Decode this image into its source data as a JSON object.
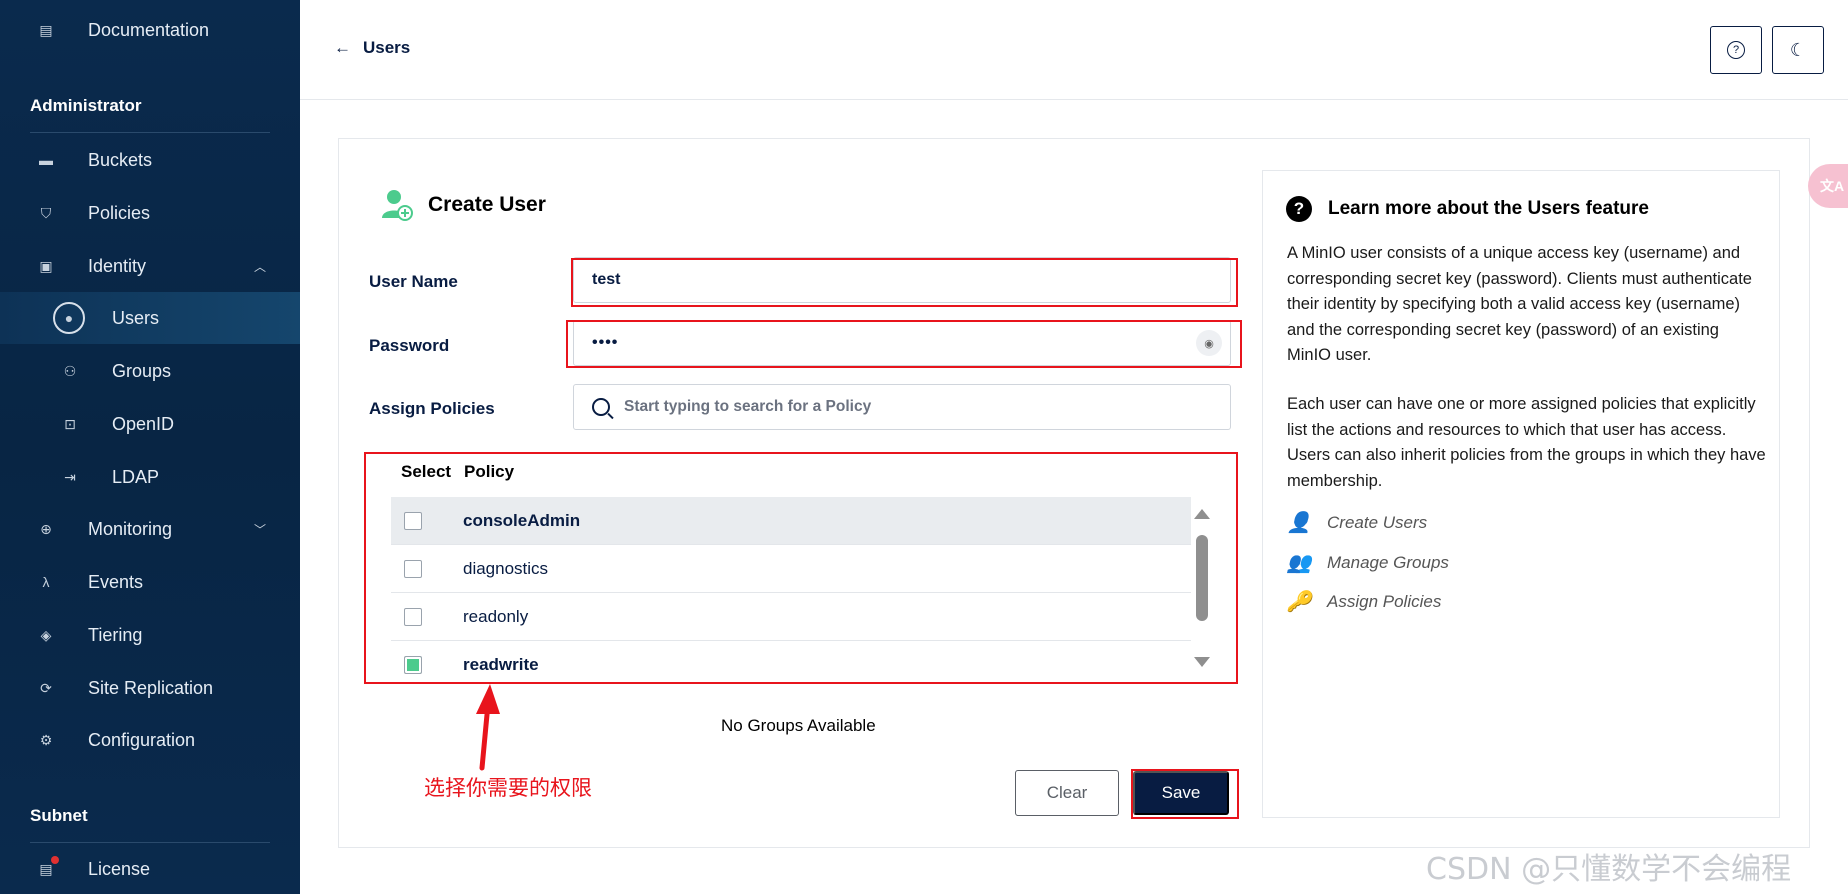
{
  "sidebar": {
    "documentation": "Documentation",
    "section_admin": "Administrator",
    "buckets": "Buckets",
    "policies": "Policies",
    "identity": "Identity",
    "users": "Users",
    "groups": "Groups",
    "openid": "OpenID",
    "ldap": "LDAP",
    "monitoring": "Monitoring",
    "events": "Events",
    "tiering": "Tiering",
    "site_replication": "Site Replication",
    "configuration": "Configuration",
    "section_subnet": "Subnet",
    "license": "License"
  },
  "header": {
    "back_label": "Users",
    "help_icon": "question-circle-icon",
    "theme_icon": "moon-icon"
  },
  "form": {
    "title": "Create User",
    "username_label": "User Name",
    "username_value": "test",
    "password_label": "Password",
    "password_value": "••••",
    "policies_label": "Assign Policies",
    "search_placeholder": "Start typing to search for a Policy",
    "col_select": "Select",
    "col_policy": "Policy",
    "policies": [
      {
        "name": "consoleAdmin",
        "checked": false,
        "highlighted": true
      },
      {
        "name": "diagnostics",
        "checked": false,
        "highlighted": false
      },
      {
        "name": "readonly",
        "checked": false,
        "highlighted": false
      },
      {
        "name": "readwrite",
        "checked": true,
        "highlighted": false
      }
    ],
    "no_groups": "No Groups Available",
    "clear_label": "Clear",
    "save_label": "Save"
  },
  "annotation": "选择你需要的权限",
  "help": {
    "title": "Learn more about the Users feature",
    "para1": "A MinIO user consists of a unique access key (username) and corresponding secret key (password). Clients must authenticate their identity by specifying both a valid access key (username) and the corresponding secret key (password) of an existing MinIO user.",
    "para2": "Each user can have one or more assigned policies that explicitly list the actions and resources to which that user has access. Users can also inherit policies from the groups in which they have membership.",
    "links": [
      "Create Users",
      "Manage Groups",
      "Assign Policies"
    ]
  },
  "watermark": "CSDN @只懂数学不会编程",
  "translate_label": "文A",
  "colors": {
    "sidebar": "#0a2a4d",
    "primary": "#081c42",
    "highlight": "#e8141c",
    "checked": "#4ccb8d"
  }
}
